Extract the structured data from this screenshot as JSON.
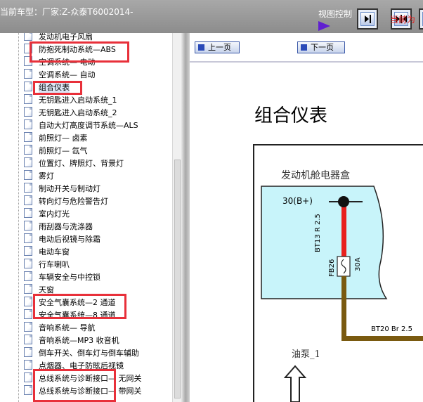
{
  "header": {
    "model_label": "当前车型：厂家:Z-众泰T6002014-",
    "view_control": "视图控制"
  },
  "toolbar": {
    "prev": "上一页",
    "next": "下一页",
    "current": "当前为"
  },
  "tree": {
    "items": [
      {
        "label": "发动机电子风扇"
      },
      {
        "label": "防抱死制动系统—ABS"
      },
      {
        "label": "空调系统— 电动"
      },
      {
        "label": "空调系统— 自动"
      },
      {
        "label": "组合仪表"
      },
      {
        "label": "无钥匙进入启动系统_1"
      },
      {
        "label": "无钥匙进入启动系统_2"
      },
      {
        "label": "自动大灯高度调节系统—ALS"
      },
      {
        "label": "前照灯— 卤素"
      },
      {
        "label": "前照灯— 氙气"
      },
      {
        "label": "位置灯、牌照灯、背景灯"
      },
      {
        "label": "雾灯"
      },
      {
        "label": "制动开关与制动灯"
      },
      {
        "label": "转向灯与危险警告灯"
      },
      {
        "label": "室内灯光"
      },
      {
        "label": "雨刮器与洗涤器"
      },
      {
        "label": "电动后视镜与除霜"
      },
      {
        "label": "电动车窗"
      },
      {
        "label": "行车喇叭"
      },
      {
        "label": "车辆安全与中控锁"
      },
      {
        "label": "天窗"
      },
      {
        "label": "安全气囊系统—2 通道"
      },
      {
        "label": "安全气囊系统—8 通道"
      },
      {
        "label": "音响系统— 导航"
      },
      {
        "label": "音响系统—MP3 收音机"
      },
      {
        "label": "倒车开关、倒车灯与倒车辅助"
      },
      {
        "label": "点烟器、电子防眩后视镜"
      },
      {
        "label": "总线系统与诊断接口— 无网关"
      },
      {
        "label": "总线系统与诊断接口— 带网关"
      }
    ]
  },
  "document": {
    "title": "组合仪表",
    "box_label": "发动机舱电器盒",
    "terminal": "30(B+)",
    "wire1": "BT13  R  2.5",
    "fuse": "FB26",
    "fuse_rating": "30A",
    "wire2": "BT20 Br 2.5",
    "pump": "油泵_1"
  },
  "colors": {
    "highlight": "#e8303a",
    "box_fill": "#c8f4fa",
    "red_wire": "#e8201e",
    "brown_wire": "#7a5a10"
  }
}
